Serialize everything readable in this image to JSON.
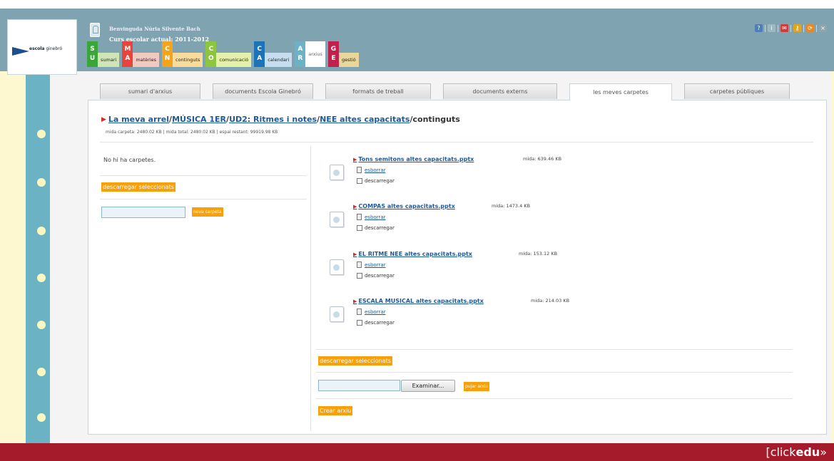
{
  "brand": {
    "logo_prefix": "escola",
    "logo_name": "ginebró",
    "footer_logo_light": "[click",
    "footer_logo_bold": "edu",
    "footer_logo_suffix": "»"
  },
  "header": {
    "welcome": "Benvinguda Núria Silvente Bach",
    "school_year": "Curs escolar actual: 2011-2012",
    "icons": [
      "help-icon",
      "info-icon",
      "mail-icon",
      "key-icon",
      "refresh-icon",
      "close-icon"
    ]
  },
  "modules": [
    {
      "badge_top": "S",
      "badge_bottom": "U",
      "label": "sumari",
      "color": "#3aa63a"
    },
    {
      "badge_top": "M",
      "badge_bottom": "A",
      "label": "matèries",
      "color": "#e8443e"
    },
    {
      "badge_top": "C",
      "badge_bottom": "N",
      "label": "continguts",
      "color": "#f2a51c"
    },
    {
      "badge_top": "C",
      "badge_bottom": "O",
      "label": "comunicació",
      "color": "#8cc63f"
    },
    {
      "badge_top": "C",
      "badge_bottom": "A",
      "label": "calendari",
      "color": "#1d73b8"
    },
    {
      "badge_top": "A",
      "badge_bottom": "R",
      "label": "arxius",
      "color": "#6bb3c4"
    },
    {
      "badge_top": "G",
      "badge_bottom": "E",
      "label": "gestió",
      "color": "#c0214c"
    }
  ],
  "subtabs": [
    "sumari d'arxius",
    "documents Escola Ginebró",
    "formats de treball",
    "documents externs",
    "les meves carpetes",
    "carpetes públiques"
  ],
  "breadcrumb": {
    "root": "La meva arrel",
    "level1": "MÚSICA 1ER",
    "level2": "UD2: Ritmes i notes",
    "level3": "NEE  altes capacitats",
    "current": "continguts",
    "sep": "/"
  },
  "size_info": "mida carpeta: 2480.02 KB | mida total: 2480.02 KB | espai restant: 99919.98 KB",
  "left_panel": {
    "no_folders": "No hi ha carpetes.",
    "download_selected": "descarregar seleccionats",
    "new_folder_value": "",
    "new_folder_button": "nova carpeta"
  },
  "files": [
    {
      "name": "Tons  semitons    altes  capacitats.pptx",
      "size": "mida: 639.46 KB",
      "erase": "esborrar",
      "download": "descarregar"
    },
    {
      "name": "COMPAS  altes  capacitats.pptx",
      "size": "mida: 1473.4 KB",
      "erase": "esborrar",
      "download": "descarregar"
    },
    {
      "name": "EL  RITME  NEE  altes  capacitats.pptx",
      "size": "mida: 153.12 KB",
      "erase": "esborrar",
      "download": "descarregar"
    },
    {
      "name": "ESCALA  MUSICAL  altes  capacitats.pptx",
      "size": "mida: 214.03 KB",
      "erase": "esborrar",
      "download": "descarregar"
    }
  ],
  "right_panel": {
    "download_selected": "descarregar seleccionats",
    "upload_value": "",
    "browse_button": "Examinar...",
    "upload_button": "pujar arxiu",
    "create_file_button": "Crear arxiu"
  }
}
